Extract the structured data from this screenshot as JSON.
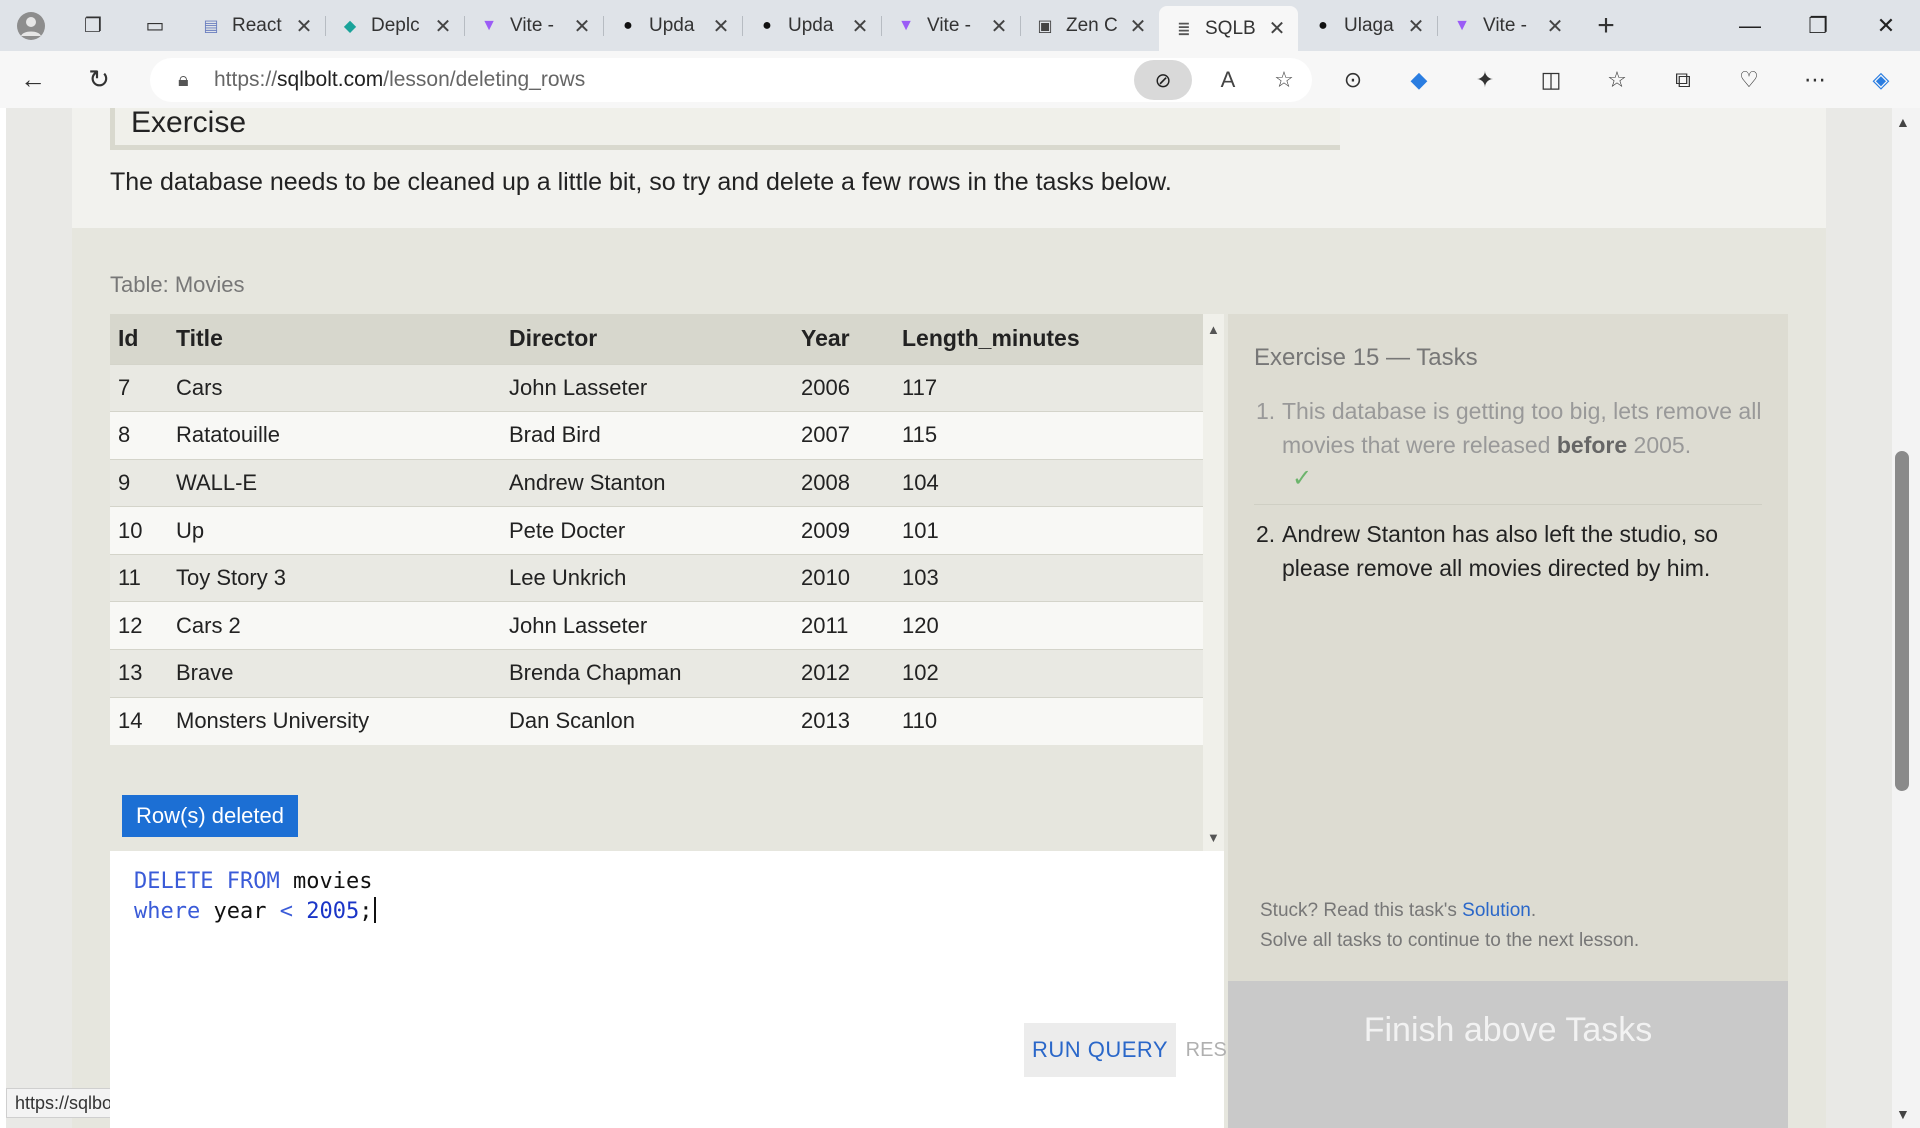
{
  "browser": {
    "tabs": [
      {
        "title": "React",
        "icon": "doc-icon"
      },
      {
        "title": "Deplc",
        "icon": "deploy-icon"
      },
      {
        "title": "Vite -",
        "icon": "vite-icon"
      },
      {
        "title": "Upda",
        "icon": "github-icon"
      },
      {
        "title": "Upda",
        "icon": "github-icon"
      },
      {
        "title": "Vite -",
        "icon": "vite-icon"
      },
      {
        "title": "Zen C",
        "icon": "zen-icon"
      },
      {
        "title": "SQLB",
        "icon": "sqlbolt-icon",
        "active": true
      },
      {
        "title": "Ulaga",
        "icon": "github-icon"
      },
      {
        "title": "Vite -",
        "icon": "vite-icon"
      }
    ],
    "url_prefix": "https://",
    "url_host": "sqlbolt.com",
    "url_path": "/lesson/deleting_rows",
    "status_url": "https://sqlbolt.com/lesson/deleting_rows#"
  },
  "page": {
    "exercise_heading": "Exercise",
    "intro": "The database needs to be cleaned up a little bit, so try and delete a few rows in the tasks below.",
    "table_label": "Table: Movies",
    "columns": [
      "Id",
      "Title",
      "Director",
      "Year",
      "Length_minutes"
    ],
    "rows": [
      [
        "7",
        "Cars",
        "John Lasseter",
        "2006",
        "117"
      ],
      [
        "8",
        "Ratatouille",
        "Brad Bird",
        "2007",
        "115"
      ],
      [
        "9",
        "WALL-E",
        "Andrew Stanton",
        "2008",
        "104"
      ],
      [
        "10",
        "Up",
        "Pete Docter",
        "2009",
        "101"
      ],
      [
        "11",
        "Toy Story 3",
        "Lee Unkrich",
        "2010",
        "103"
      ],
      [
        "12",
        "Cars 2",
        "John Lasseter",
        "2011",
        "120"
      ],
      [
        "13",
        "Brave",
        "Brenda Chapman",
        "2012",
        "102"
      ],
      [
        "14",
        "Monsters University",
        "Dan Scanlon",
        "2013",
        "110"
      ]
    ],
    "status_badge": "Row(s) deleted",
    "query": {
      "line1_kw1": "DELETE",
      "line1_kw2": "FROM",
      "line1_table": "movies",
      "line2_kw": "where",
      "line2_col": "year",
      "line2_op": "<",
      "line2_num": "2005",
      "line2_end": ";"
    },
    "run_button": "RUN QUERY",
    "reset_button": "RESET"
  },
  "tasks": {
    "heading": "Exercise 15 — Tasks",
    "task1_num": "1.",
    "task1_pre": "This database is getting too big, lets remove all movies that were released",
    "task1_bold": "before",
    "task1_post": "2005.",
    "task1_check": "✓",
    "task2_num": "2.",
    "task2": "Andrew Stanton has also left the studio, so please remove all movies directed by him.",
    "help_pre": "Stuck? Read this task's",
    "help_link": "Solution",
    "help_post": ".",
    "help_line2": "Solve all tasks to continue to the next lesson.",
    "finish_button": "Finish above Tasks"
  },
  "colors": {
    "accent": "#1c6fd4",
    "link": "#2a67c9",
    "check": "#6cb46c"
  }
}
